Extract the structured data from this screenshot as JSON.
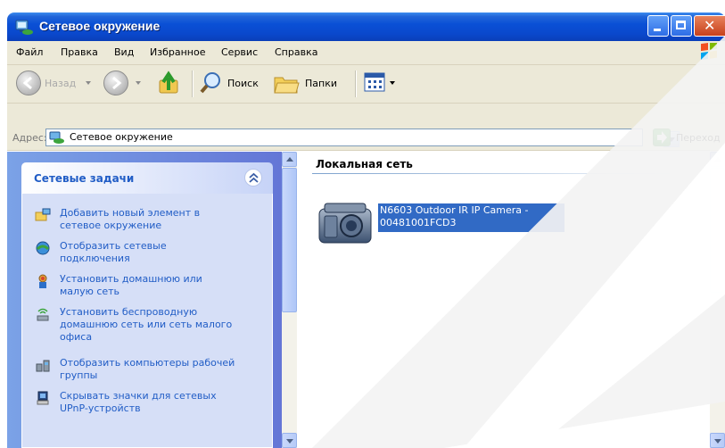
{
  "window": {
    "title": "Сетевое окружение"
  },
  "menu": {
    "items": [
      "Файл",
      "Правка",
      "Вид",
      "Избранное",
      "Сервис",
      "Справка"
    ]
  },
  "toolbar": {
    "back_label": "Назад",
    "search_label": "Поиск",
    "folders_label": "Папки"
  },
  "address": {
    "label": "Адрес:",
    "value": "Сетевое окружение",
    "go_label": "Переход"
  },
  "tasks": {
    "title": "Сетевые задачи",
    "items": [
      {
        "label": "Добавить новый элемент в сетевое окружение",
        "icon": "add-network-place-icon"
      },
      {
        "label": "Отобразить сетевые подключения",
        "icon": "network-connections-icon"
      },
      {
        "label": "Установить домашнюю или малую сеть",
        "icon": "home-network-icon"
      },
      {
        "label": "Установить беспроводную домашнюю сеть или сеть малого офиса",
        "icon": "wireless-network-icon"
      },
      {
        "label": "Отобразить компьютеры рабочей группы",
        "icon": "workgroup-icon"
      },
      {
        "label": "Скрывать значки для сетевых UPnP-устройств",
        "icon": "upnp-device-icon"
      }
    ]
  },
  "content": {
    "group_title": "Локальная сеть",
    "items": [
      {
        "label_line1": "N6603 Outdoor IR IP Camera -",
        "label_line2": "00481001FCD3",
        "icon": "camera-device-icon"
      }
    ]
  },
  "colors": {
    "title_bar": "#0a50d6",
    "task_pane": "#7ba2e7",
    "task_link": "#215dc6",
    "selection": "#316ac5"
  }
}
